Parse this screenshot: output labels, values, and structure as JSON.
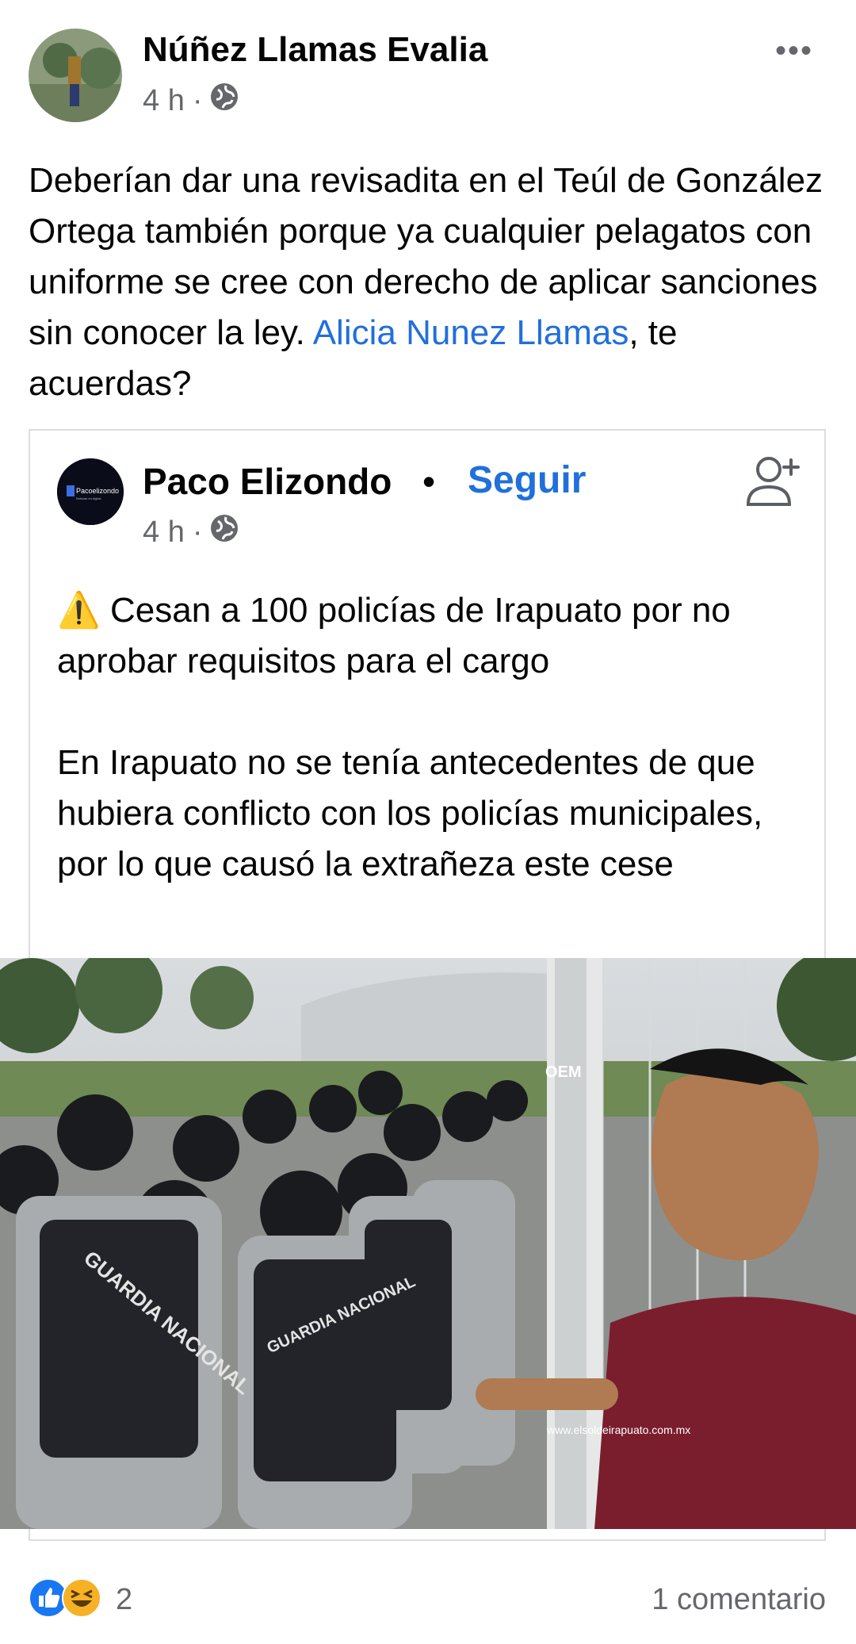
{
  "post": {
    "author": "Núñez Llamas Evalia",
    "time": "4 h",
    "separator": "·",
    "audience_icon": "globe-icon",
    "more_label": "•••",
    "text_before": "Deberían dar una revisadita en el Teúl de González Ortega también porque ya cualquier pelagatos con uniforme se cree con derecho de aplicar sanciones sin conocer la ley. ",
    "mention": "Alicia Nunez Llamas",
    "text_after": ", te acuerdas?"
  },
  "shared": {
    "author": "Paco Elizondo",
    "dot": "•",
    "follow_label": "Seguir",
    "time": "4 h",
    "separator": "·",
    "logo_text": "Pacoelizondo",
    "logo_subtext": "Noticias en digital",
    "headline": "⚠️ Cesan a 100 policías de Irapuato por no aprobar requisitos para el cargo",
    "body": "En Irapuato no se tenía antecedentes de que hubiera conflicto con los policías municipales, por lo que causó la extrañeza este cese"
  },
  "photo": {
    "vest_label_1": "GUARDIA NACIONAL",
    "vest_label_2": "GUARDIA NACIONAL",
    "watermark_logo": "OEM",
    "watermark_url": "www.elsoldeirapuato.com.mx"
  },
  "footer": {
    "reaction_count": "2",
    "comments": "1 comentario"
  },
  "colors": {
    "link": "#216fdb",
    "muted": "#65676b",
    "like": "#1877f2",
    "haha": "#f7b125"
  }
}
